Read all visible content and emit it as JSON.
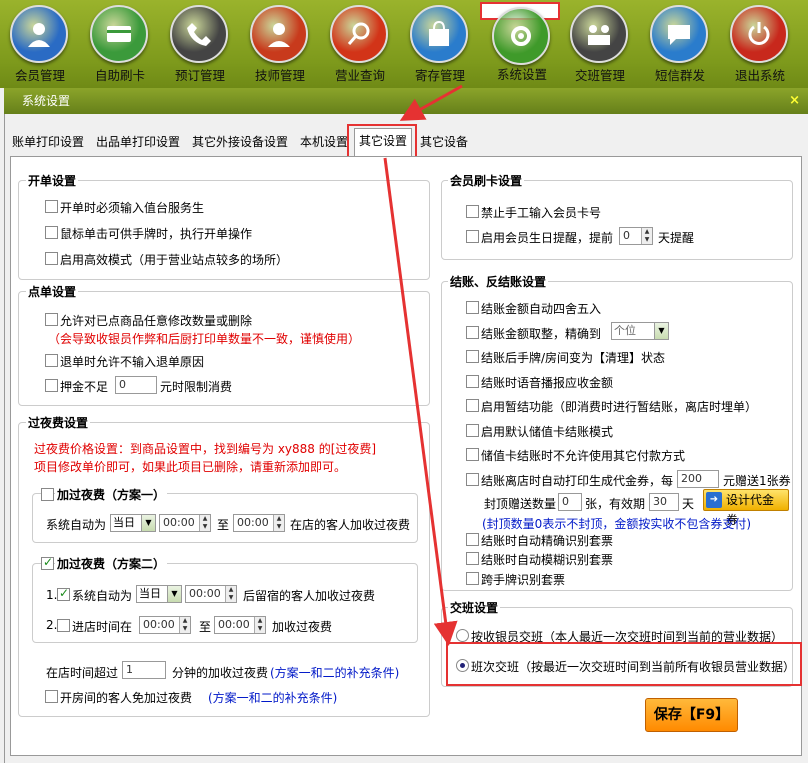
{
  "toolbar": [
    {
      "label": "会员管理",
      "icon": "member-icon",
      "color": "#2a6bc4"
    },
    {
      "label": "自助刷卡",
      "icon": "card-icon",
      "color": "#3b9a3b"
    },
    {
      "label": "预订管理",
      "icon": "phone-icon",
      "color": "#444444"
    },
    {
      "label": "技师管理",
      "icon": "technician-icon",
      "color": "#c83a1c"
    },
    {
      "label": "营业查询",
      "icon": "search-icon",
      "color": "#d23418"
    },
    {
      "label": "寄存管理",
      "icon": "bag-icon",
      "color": "#2a7ccc"
    },
    {
      "label": "系统设置",
      "icon": "gear-icon",
      "color": "#3f9a2a"
    },
    {
      "label": "交班管理",
      "icon": "handover-icon",
      "color": "#444444"
    },
    {
      "label": "短信群发",
      "icon": "sms-icon",
      "color": "#2a7ccc"
    },
    {
      "label": "退出系统",
      "icon": "power-icon",
      "color": "#c8281c"
    }
  ],
  "window": {
    "title": "系统设置",
    "close": "×"
  },
  "tabs": [
    "账单打印设置",
    "出品单打印设置",
    "其它外接设备设置",
    "本机设置",
    "其它设置",
    "其它设备"
  ],
  "open": {
    "legend": "开单设置",
    "items": [
      "开单时必须输入值台服务生",
      "鼠标单击可供手牌时，执行开单操作",
      "启用高效模式（用于营业站点较多的场所）"
    ]
  },
  "order": {
    "legend": "点单设置",
    "item1": "允许对已点商品任意修改数量或删除",
    "warn": "（会导致收银员作弊和后厨打印单数量不一致，谨慎使用）",
    "item2": "退单时允许不输入退单原因",
    "item3a": "押金不足",
    "item3v": "0",
    "item3b": "元时限制消费"
  },
  "overnight": {
    "legend": "过夜费设置",
    "note1": "过夜费价格设置：到商品设置中，找到编号为 xy888 的[过夜费]",
    "note2": "项目修改单价即可，如果此项目已删除，请重新添加即可。",
    "plan1": {
      "legend": "加过夜费（方案一）",
      "a": "系统自动为",
      "day": "当日",
      "t1": "00:00",
      "to": "至",
      "t2": "00:00",
      "b": "在店的客人加收过夜费"
    },
    "plan2": {
      "legend": "加过夜费（方案二）",
      "n1": "1.",
      "a": "系统自动为",
      "day": "当日",
      "t1": "00:00",
      "b": "后留宿的客人加收过夜费",
      "n2": "2.",
      "c": "进店时间在",
      "t2": "00:00",
      "to": "至",
      "t3": "00:00",
      "d": "加收过夜费"
    },
    "stay_a": "在店时间超过",
    "stay_v": "1",
    "stay_b": "分钟的加收过夜费",
    "stay_note": "(方案一和二的补充条件)",
    "room": "开房间的客人免加过夜费",
    "room_note": "(方案一和二的补充条件)"
  },
  "card": {
    "legend": "会员刷卡设置",
    "item1": "禁止手工输入会员卡号",
    "item2a": "启用会员生日提醒，提前",
    "item2v": "0",
    "item2b": "天提醒"
  },
  "checkout": {
    "legend": "结账、反结账设置",
    "items": [
      "结账金额自动四舍五入",
      "结账金额取整，精确到",
      "结账后手牌/房间变为【清理】状态",
      "结账时语音播报应收金额",
      "启用暂结功能（即消费时进行暂结账，离店时埋单）",
      "启用默认储值卡结账模式",
      "储值卡结账时不允许使用其它付款方式",
      "结账离店时自动打印生成代金券，每"
    ],
    "precision": "个位",
    "coupon_every": "200",
    "coupon_b": "元赠送1张券",
    "cap_a": "封顶赠送数量",
    "cap_v": "0",
    "cap_b": "张，有效期",
    "valid_v": "30",
    "valid_b": "天",
    "design": "设计代金券",
    "cap_note": "(封顶数量0表示不封顶，金额按实收不包含券支付)",
    "items2": [
      "结账时自动精确识别套票",
      "结账时自动模糊识别套票",
      "跨手牌识别套票"
    ]
  },
  "shift": {
    "legend": "交班设置",
    "opt1": "按收银员交班（本人最近一次交班时间到当前的营业数据）",
    "opt2": "班次交班（按最近一次交班时间到当前所有收银员营业数据）"
  },
  "save": "保存【F9】"
}
